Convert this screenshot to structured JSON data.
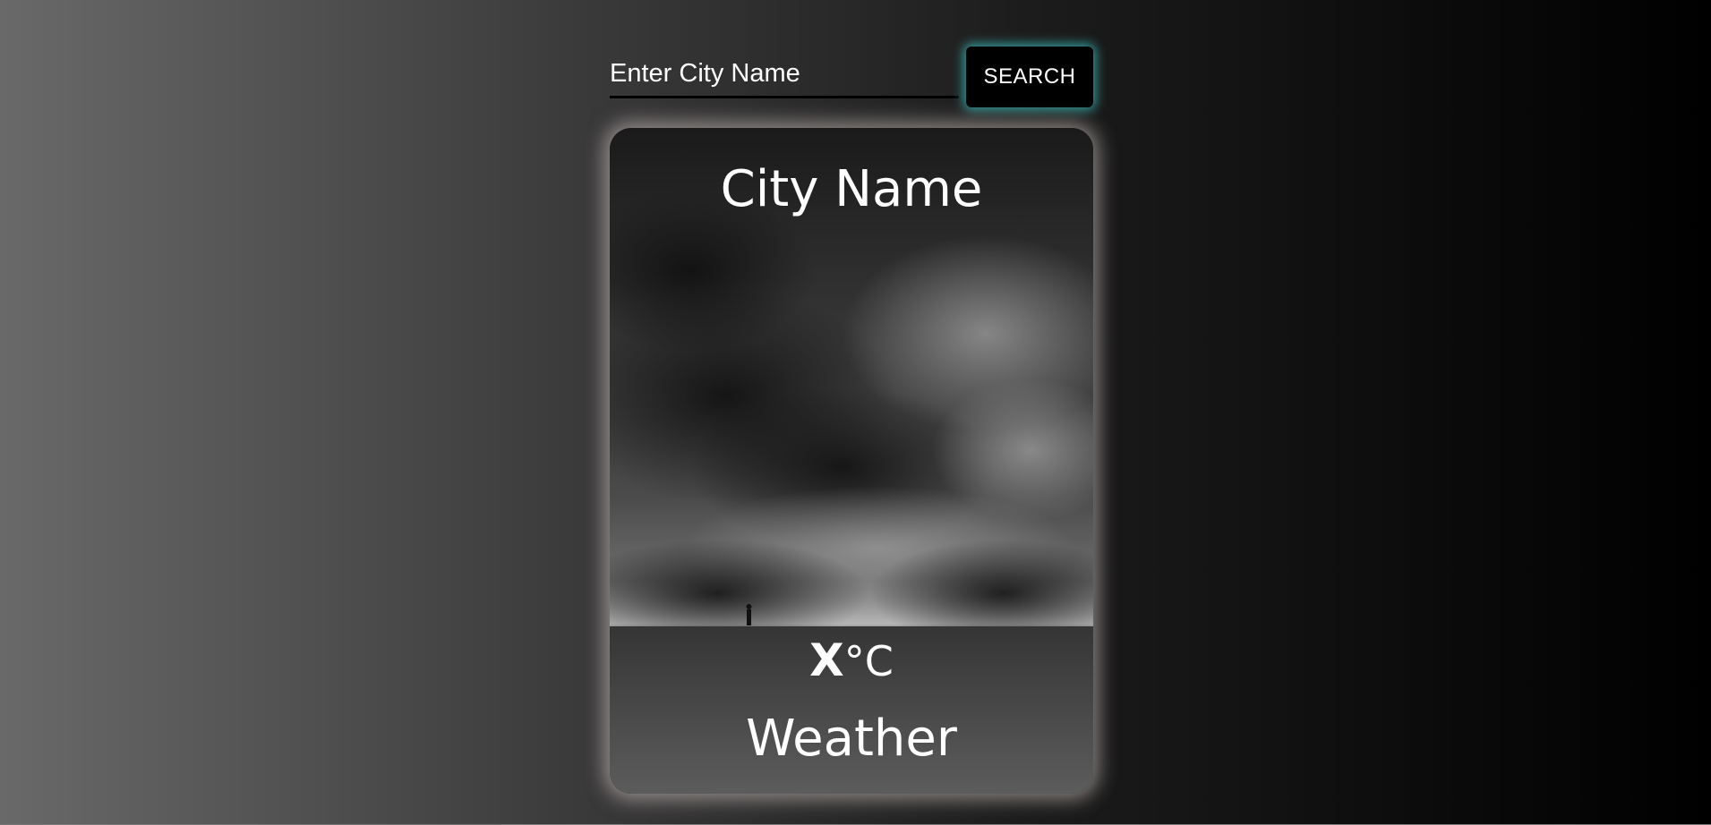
{
  "search": {
    "placeholder": "Enter City Name",
    "value": "",
    "button_label": "SEARCH"
  },
  "card": {
    "city_name": "City Name",
    "temperature": {
      "value": "X",
      "unit": "°C"
    },
    "condition": "Weather",
    "background_icon": "storm-clouds-field-image"
  },
  "colors": {
    "accent_glow": "#3cc8c8",
    "card_glow": "#e1d7d2",
    "text": "#ffffff"
  }
}
